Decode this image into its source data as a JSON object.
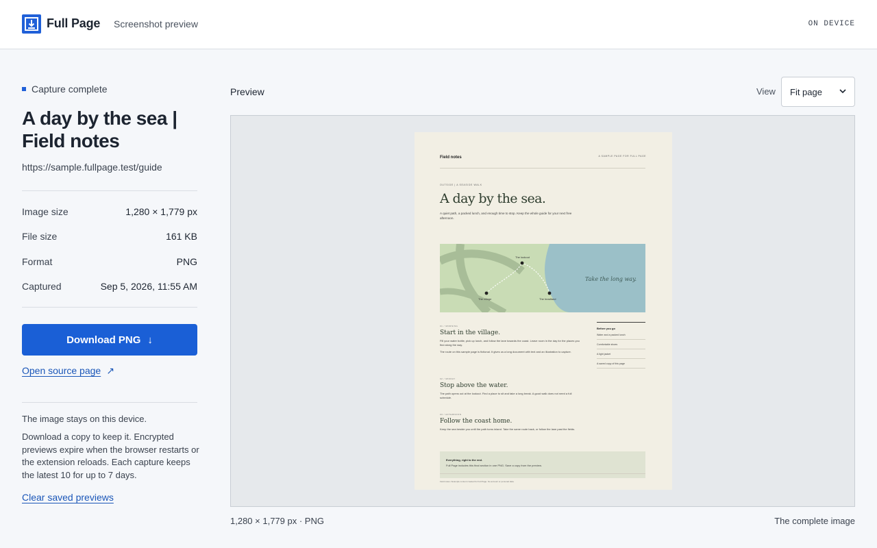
{
  "header": {
    "app_name": "Full Page",
    "subtitle": "Screenshot preview",
    "device_badge": "ON DEVICE",
    "logo_icon": "download-tray-icon",
    "accent_color": "#2060d8"
  },
  "sidebar": {
    "status": "Capture complete",
    "title": "A day by the sea | Field notes",
    "url": "https://sample.fullpage.test/guide",
    "meta": [
      {
        "label": "Image size",
        "value": "1,280 × 1,779 px"
      },
      {
        "label": "File size",
        "value": "161 KB"
      },
      {
        "label": "Format",
        "value": "PNG"
      },
      {
        "label": "Captured",
        "value": "Sep 5, 2026, 11:55 AM"
      }
    ],
    "download_label": "Download PNG",
    "download_icon": "↓",
    "open_source_label": "Open source page",
    "external_icon": "↗",
    "note_primary": "The image stays on this device.",
    "note_secondary": "Download a copy to keep it. Encrypted previews expire when the browser restarts or the extension reloads. Each capture keeps the latest 10 for up to 7 days.",
    "clear_label": "Clear saved previews"
  },
  "preview": {
    "label": "Preview",
    "view_label": "View",
    "view_selected": "Fit page",
    "footer_info": "1,280 × 1,779 px · PNG",
    "footer_caption": "The complete image"
  },
  "thumbnail": {
    "site_name": "Field notes",
    "sample_note": "A SAMPLE PAGE FOR FULL PAGE",
    "kicker": "OUTSIDE | A SEASIDE WALK",
    "headline": "A day by the sea.",
    "intro": "A quiet path, a packed lunch, and enough time to stop. Keep the whole guide for your next free afternoon.",
    "map_tagline": "Take the long way.",
    "map_points": [
      "The lookout",
      "The village",
      "The headland"
    ],
    "sections": [
      {
        "kicker": "01 / MORNING",
        "heading": "Start in the village.",
        "body": "Fill your water bottle, pick up lunch, and follow the lane towards the coast. Leave room in the day for the places you find along the way.",
        "body2": "The route on this sample page is fictional. It gives us a long document with text and an illustration to capture."
      },
      {
        "kicker": "02 / MIDDAY",
        "heading": "Stop above the water.",
        "body": "The path opens out at the lookout. Find a place to sit and take a long break. A good walk does not need a full schedule."
      },
      {
        "kicker": "03 / AFTERNOON",
        "heading": "Follow the coast home.",
        "body": "Keep the sea beside you until the path turns inland. Take the same route back, or follow the lane past the fields."
      }
    ],
    "aside_heading": "Before you go",
    "aside_items": [
      "Water and a packed lunch",
      "Comfortable shoes",
      "A light jacket",
      "A saved copy of this page"
    ],
    "box_title": "Everything, right to the end.",
    "box_body": "Full Page includes this final section in one PNG. Save a copy from the preview.",
    "footer": "Field notes / Example content created for Full Page. No account or personal data."
  }
}
